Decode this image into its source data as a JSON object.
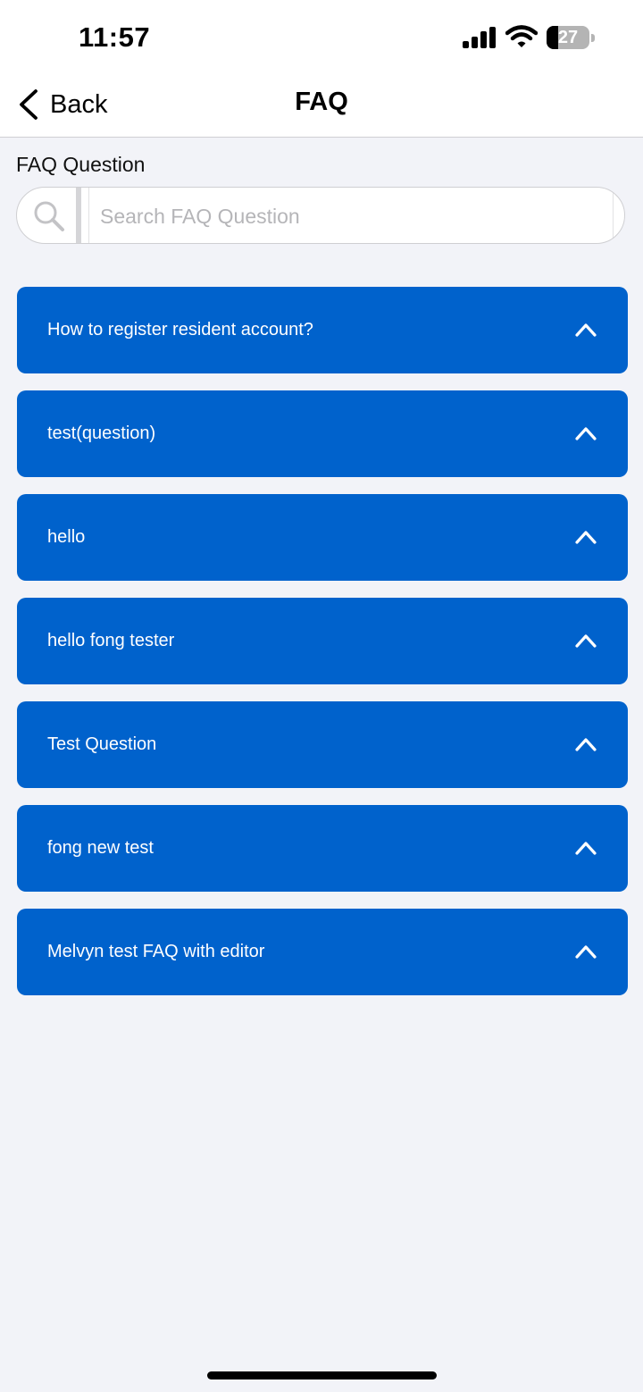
{
  "status_bar": {
    "time": "11:57",
    "battery_level": "27",
    "battery_fraction": 0.27
  },
  "nav": {
    "back_label": "Back",
    "title": "FAQ"
  },
  "search": {
    "label": "FAQ Question",
    "placeholder": "Search FAQ Question",
    "value": ""
  },
  "faq": {
    "items": [
      {
        "question": "How to register resident account?",
        "expanded": false
      },
      {
        "question": "test(question)",
        "expanded": false
      },
      {
        "question": "hello",
        "expanded": false
      },
      {
        "question": "hello fong tester",
        "expanded": false
      },
      {
        "question": "Test Question",
        "expanded": false
      },
      {
        "question": "fong new test",
        "expanded": false
      },
      {
        "question": "Melvyn test FAQ with editor",
        "expanded": false
      }
    ]
  },
  "colors": {
    "accent": "#0062cc",
    "background": "#f2f3f8",
    "header": "#ffffff"
  },
  "icons": {
    "back": "chevron-left-icon",
    "search": "search-icon",
    "item_toggle": "chevron-up-icon",
    "signal": "signal-icon",
    "wifi": "wifi-icon",
    "battery": "battery-icon"
  }
}
